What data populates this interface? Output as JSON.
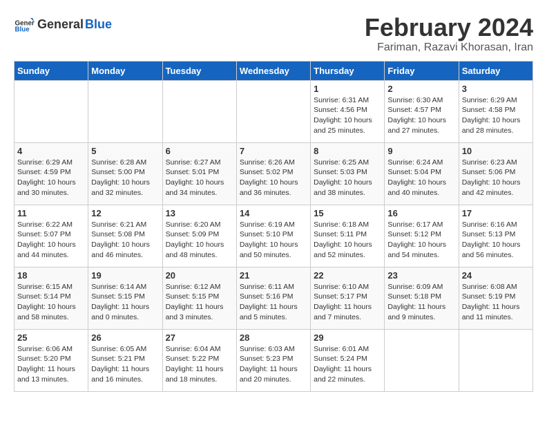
{
  "header": {
    "logo_general": "General",
    "logo_blue": "Blue",
    "title": "February 2024",
    "subtitle": "Fariman, Razavi Khorasan, Iran"
  },
  "days_of_week": [
    "Sunday",
    "Monday",
    "Tuesday",
    "Wednesday",
    "Thursday",
    "Friday",
    "Saturday"
  ],
  "weeks": [
    {
      "days": [
        {
          "number": "",
          "info": ""
        },
        {
          "number": "",
          "info": ""
        },
        {
          "number": "",
          "info": ""
        },
        {
          "number": "",
          "info": ""
        },
        {
          "number": "1",
          "info": "Sunrise: 6:31 AM\nSunset: 4:56 PM\nDaylight: 10 hours and 25 minutes."
        },
        {
          "number": "2",
          "info": "Sunrise: 6:30 AM\nSunset: 4:57 PM\nDaylight: 10 hours and 27 minutes."
        },
        {
          "number": "3",
          "info": "Sunrise: 6:29 AM\nSunset: 4:58 PM\nDaylight: 10 hours and 28 minutes."
        }
      ]
    },
    {
      "days": [
        {
          "number": "4",
          "info": "Sunrise: 6:29 AM\nSunset: 4:59 PM\nDaylight: 10 hours and 30 minutes."
        },
        {
          "number": "5",
          "info": "Sunrise: 6:28 AM\nSunset: 5:00 PM\nDaylight: 10 hours and 32 minutes."
        },
        {
          "number": "6",
          "info": "Sunrise: 6:27 AM\nSunset: 5:01 PM\nDaylight: 10 hours and 34 minutes."
        },
        {
          "number": "7",
          "info": "Sunrise: 6:26 AM\nSunset: 5:02 PM\nDaylight: 10 hours and 36 minutes."
        },
        {
          "number": "8",
          "info": "Sunrise: 6:25 AM\nSunset: 5:03 PM\nDaylight: 10 hours and 38 minutes."
        },
        {
          "number": "9",
          "info": "Sunrise: 6:24 AM\nSunset: 5:04 PM\nDaylight: 10 hours and 40 minutes."
        },
        {
          "number": "10",
          "info": "Sunrise: 6:23 AM\nSunset: 5:06 PM\nDaylight: 10 hours and 42 minutes."
        }
      ]
    },
    {
      "days": [
        {
          "number": "11",
          "info": "Sunrise: 6:22 AM\nSunset: 5:07 PM\nDaylight: 10 hours and 44 minutes."
        },
        {
          "number": "12",
          "info": "Sunrise: 6:21 AM\nSunset: 5:08 PM\nDaylight: 10 hours and 46 minutes."
        },
        {
          "number": "13",
          "info": "Sunrise: 6:20 AM\nSunset: 5:09 PM\nDaylight: 10 hours and 48 minutes."
        },
        {
          "number": "14",
          "info": "Sunrise: 6:19 AM\nSunset: 5:10 PM\nDaylight: 10 hours and 50 minutes."
        },
        {
          "number": "15",
          "info": "Sunrise: 6:18 AM\nSunset: 5:11 PM\nDaylight: 10 hours and 52 minutes."
        },
        {
          "number": "16",
          "info": "Sunrise: 6:17 AM\nSunset: 5:12 PM\nDaylight: 10 hours and 54 minutes."
        },
        {
          "number": "17",
          "info": "Sunrise: 6:16 AM\nSunset: 5:13 PM\nDaylight: 10 hours and 56 minutes."
        }
      ]
    },
    {
      "days": [
        {
          "number": "18",
          "info": "Sunrise: 6:15 AM\nSunset: 5:14 PM\nDaylight: 10 hours and 58 minutes."
        },
        {
          "number": "19",
          "info": "Sunrise: 6:14 AM\nSunset: 5:15 PM\nDaylight: 11 hours and 0 minutes."
        },
        {
          "number": "20",
          "info": "Sunrise: 6:12 AM\nSunset: 5:15 PM\nDaylight: 11 hours and 3 minutes."
        },
        {
          "number": "21",
          "info": "Sunrise: 6:11 AM\nSunset: 5:16 PM\nDaylight: 11 hours and 5 minutes."
        },
        {
          "number": "22",
          "info": "Sunrise: 6:10 AM\nSunset: 5:17 PM\nDaylight: 11 hours and 7 minutes."
        },
        {
          "number": "23",
          "info": "Sunrise: 6:09 AM\nSunset: 5:18 PM\nDaylight: 11 hours and 9 minutes."
        },
        {
          "number": "24",
          "info": "Sunrise: 6:08 AM\nSunset: 5:19 PM\nDaylight: 11 hours and 11 minutes."
        }
      ]
    },
    {
      "days": [
        {
          "number": "25",
          "info": "Sunrise: 6:06 AM\nSunset: 5:20 PM\nDaylight: 11 hours and 13 minutes."
        },
        {
          "number": "26",
          "info": "Sunrise: 6:05 AM\nSunset: 5:21 PM\nDaylight: 11 hours and 16 minutes."
        },
        {
          "number": "27",
          "info": "Sunrise: 6:04 AM\nSunset: 5:22 PM\nDaylight: 11 hours and 18 minutes."
        },
        {
          "number": "28",
          "info": "Sunrise: 6:03 AM\nSunset: 5:23 PM\nDaylight: 11 hours and 20 minutes."
        },
        {
          "number": "29",
          "info": "Sunrise: 6:01 AM\nSunset: 5:24 PM\nDaylight: 11 hours and 22 minutes."
        },
        {
          "number": "",
          "info": ""
        },
        {
          "number": "",
          "info": ""
        }
      ]
    }
  ]
}
